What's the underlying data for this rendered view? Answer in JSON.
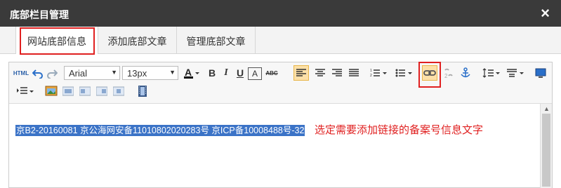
{
  "window": {
    "title": "底部栏目管理",
    "close_icon": "×"
  },
  "tabs": [
    {
      "label": "网站底部信息",
      "active": true
    },
    {
      "label": "添加底部文章",
      "active": false
    },
    {
      "label": "管理底部文章",
      "active": false
    }
  ],
  "toolbar": {
    "html_label": "HTML",
    "font_family": "Arial",
    "font_size": "13px",
    "bold_label": "B",
    "italic_label": "I",
    "underline_label": "U",
    "outline_label": "A",
    "strike_label": "ABC"
  },
  "editor": {
    "selected_text": "京B2-20160081 京公海网安备11010802020283号 京ICP备10008488号-32"
  },
  "annotation": "选定需要添加链接的备案号信息文字",
  "colors": {
    "highlight": "#e02020",
    "selection": "#3b73c7",
    "titlebar": "#3a3a3a"
  }
}
